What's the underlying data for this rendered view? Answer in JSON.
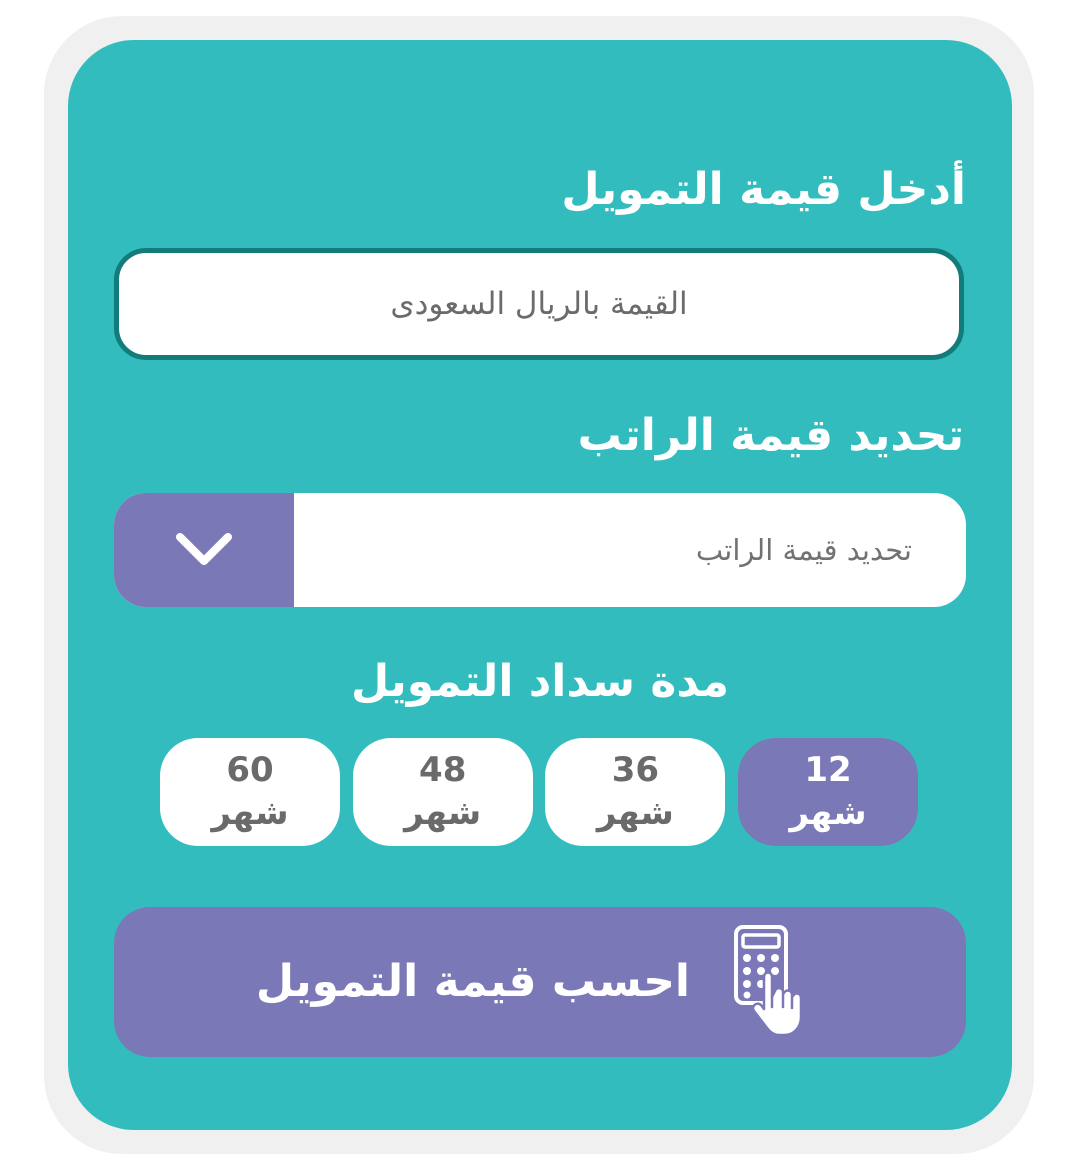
{
  "form": {
    "amount_heading": "أدخل قيمة التمويل",
    "amount_placeholder": "القيمة بالريال السعودى",
    "amount_value": "",
    "salary_heading": "تحديد قيمة الراتب",
    "salary_selected": "تحديد قيمة الراتب",
    "salary_arrow_icon": "chevron-down-icon",
    "duration_heading": "مدة سداد التمويل",
    "durations": [
      {
        "number": "12",
        "unit": "شهر",
        "selected": true
      },
      {
        "number": "36",
        "unit": "شهر",
        "selected": false
      },
      {
        "number": "48",
        "unit": "شهر",
        "selected": false
      },
      {
        "number": "60",
        "unit": "شهر",
        "selected": false
      }
    ],
    "calculate_label": "احسب قيمة التمويل",
    "calculate_icon": "calculator-hand-icon"
  },
  "colors": {
    "card_background": "#33bcbd",
    "accent_purple": "#7b78b7",
    "input_border": "#137b7a",
    "frame_background": "#f0f0f0"
  }
}
